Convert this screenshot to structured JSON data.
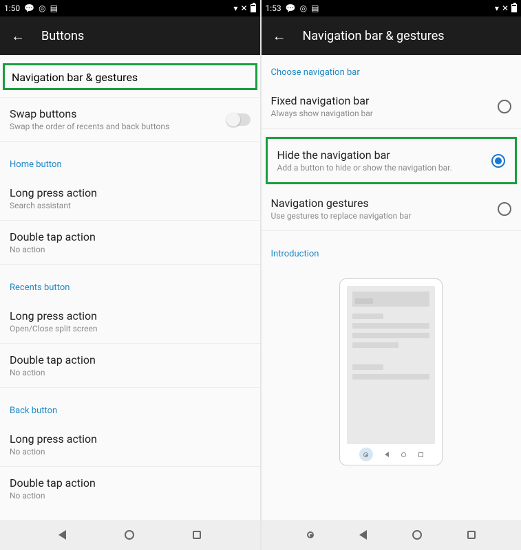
{
  "left": {
    "status_time": "1:50",
    "app_title": "Buttons",
    "highlight_title": "Navigation bar & gestures",
    "swap": {
      "title": "Swap buttons",
      "sub": "Swap the order of recents and back buttons"
    },
    "section_home": "Home button",
    "home_long": {
      "title": "Long press action",
      "sub": "Search assistant"
    },
    "home_double": {
      "title": "Double tap action",
      "sub": "No action"
    },
    "section_recents": "Recents button",
    "recents_long": {
      "title": "Long press action",
      "sub": "Open/Close split screen"
    },
    "recents_double": {
      "title": "Double tap action",
      "sub": "No action"
    },
    "section_back": "Back button",
    "back_long": {
      "title": "Long press action",
      "sub": "No action"
    },
    "back_double": {
      "title": "Double tap action",
      "sub": "No action"
    }
  },
  "right": {
    "status_time": "1:53",
    "app_title": "Navigation bar & gestures",
    "section_choose": "Choose navigation bar",
    "opt_fixed": {
      "title": "Fixed navigation bar",
      "sub": "Always show navigation bar"
    },
    "opt_hide": {
      "title": "Hide the navigation bar",
      "sub": "Add a button to hide or show the navigation bar."
    },
    "opt_gest": {
      "title": "Navigation gestures",
      "sub": "Use gestures to replace navigation bar"
    },
    "section_intro": "Introduction"
  }
}
